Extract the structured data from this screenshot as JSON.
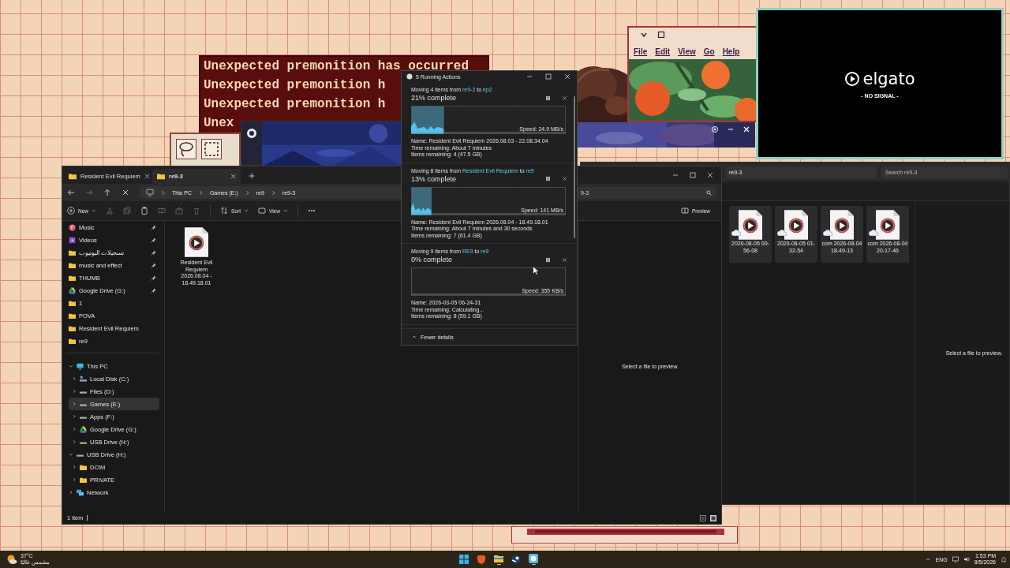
{
  "premonition_window": {
    "lines": [
      "Unexpected premonition has occurred",
      "Unexpected premonition h",
      "Unexpected premonition h",
      "Unex"
    ]
  },
  "retro_window": {
    "menu": [
      "File",
      "Edit",
      "View",
      "Go",
      "Help"
    ]
  },
  "capture_window": {
    "brand": "elgato",
    "status": "- NO SIGNAL -"
  },
  "explorer": {
    "tabs": [
      {
        "label": "Resident Evil Requiem",
        "selected": false
      },
      {
        "label": "re9-3",
        "selected": true
      }
    ],
    "breadcrumb": [
      "This PC",
      "Games (E:)",
      "re9",
      "re9-3"
    ],
    "search": {
      "value": "9-3"
    },
    "toolbar": {
      "new": "New",
      "sort": "Sort",
      "view": "View",
      "preview": "Preview"
    },
    "sidebar": {
      "quick_access": [
        {
          "label": "Music",
          "kind": "music",
          "pinned": true,
          "selected": false
        },
        {
          "label": "Videos",
          "kind": "videos",
          "pinned": true,
          "selected": false
        },
        {
          "label": "تسجيلات اليوتيوب",
          "kind": "folder",
          "pinned": true,
          "selected": false
        },
        {
          "label": "music and effect",
          "kind": "folder",
          "pinned": true,
          "selected": false
        },
        {
          "label": "THUMB",
          "kind": "folder",
          "pinned": true,
          "selected": false
        },
        {
          "label": "Google Drive (G:)",
          "kind": "cloud",
          "pinned": true,
          "selected": false
        },
        {
          "label": "1",
          "kind": "folder",
          "pinned": false,
          "selected": false
        },
        {
          "label": "POVA",
          "kind": "folder",
          "pinned": false,
          "selected": false
        },
        {
          "label": "Resident Evil Requiem",
          "kind": "folder",
          "pinned": false,
          "selected": false
        },
        {
          "label": "re9",
          "kind": "folder",
          "pinned": false,
          "selected": false
        }
      ],
      "tree": [
        {
          "label": "This PC",
          "kind": "pc",
          "expanded": true,
          "selected": false,
          "children": [
            {
              "label": "Local Disk (C:)",
              "kind": "system",
              "expanded": false,
              "selected": false
            },
            {
              "label": "Files (D:)",
              "kind": "disk",
              "expanded": false,
              "selected": false
            },
            {
              "label": "Games (E:)",
              "kind": "disk",
              "expanded": false,
              "selected": true
            },
            {
              "label": "Apps (F:)",
              "kind": "disk",
              "expanded": false,
              "selected": false
            },
            {
              "label": "Google Drive (G:)",
              "kind": "cloud",
              "expanded": false,
              "selected": false
            },
            {
              "label": "USB Drive (H:)",
              "kind": "disk",
              "expanded": false,
              "selected": false
            }
          ]
        },
        {
          "label": "USB Drive (H:)",
          "kind": "disk",
          "expanded": true,
          "selected": false,
          "children": [
            {
              "label": "DCIM",
              "kind": "folder",
              "expanded": false,
              "selected": false
            },
            {
              "label": "PRIVATE",
              "kind": "folder",
              "expanded": false,
              "selected": false
            }
          ]
        },
        {
          "label": "Network",
          "kind": "network",
          "expanded": false,
          "selected": false
        }
      ]
    },
    "files": [
      {
        "name": "Resident Evil Requiem 2026.08.04 - 18.49.18.01"
      }
    ],
    "preview_message": "Select a file to preview.",
    "status": "1 item"
  },
  "second_explorer": {
    "address": "re9-3",
    "search": {
      "placeholder": "Search re9-3"
    },
    "files": [
      {
        "name": "2026-08-05 00-56-08"
      },
      {
        "name": "2026-08-05 01-32-54"
      },
      {
        "name": "com 2026-08-04 18-49-13"
      },
      {
        "name": "com 2026-08-04 20-17-46"
      }
    ],
    "preview_message": "Select a file to preview."
  },
  "copy_dialog": {
    "title": "5 Running Actions",
    "operations": [
      {
        "prefix": "Moving 4 items from",
        "source": "re9-2",
        "joiner": "to",
        "destination": "ep2",
        "progress": "21% complete",
        "level": 0.21,
        "speed": "Speed: 24.9 MB/s",
        "details": [
          "Name: Resident Evil Requiem 2026.08.03 - 22.08.34.04",
          "Time remaining: About 7 minutes",
          "Items remaining: 4 (47.5 GB)"
        ]
      },
      {
        "prefix": "Moving 8 items from",
        "source": "Resident Evil Requiem",
        "joiner": "to",
        "destination": "re9",
        "progress": "13% complete",
        "level": 0.13,
        "speed": "Speed: 141 MB/s",
        "details": [
          "Name: Resident Evil Requiem 2026.08.04 - 18.49.18.01",
          "Time remaining: About 7 minutes and 30 seconds",
          "Items remaining: 7 (61.4 GB)"
        ]
      },
      {
        "prefix": "Moving 9 items from",
        "source": "RE9",
        "joiner": "to",
        "destination": "re9",
        "progress": "0% complete",
        "level": 0,
        "speed": "Speed: 355 KB/s",
        "details": [
          "Name: 2026-03-05 06-24-31",
          "Time remaining: Calculating...",
          "Items remaining: 8 (59.1 GB)"
        ]
      }
    ],
    "footer": "Fewer details"
  },
  "taskbar": {
    "weather": {
      "temperature": "37°C",
      "condition": "مشمس غالبًا"
    },
    "apps": [
      {
        "kind": "start",
        "running": false
      },
      {
        "kind": "browser",
        "running": false
      },
      {
        "kind": "files",
        "running": true
      },
      {
        "kind": "game",
        "running": false
      },
      {
        "kind": "chat",
        "running": true
      }
    ],
    "language": "ENG",
    "time": "1:53 PM",
    "date": "8/5/2026"
  }
}
